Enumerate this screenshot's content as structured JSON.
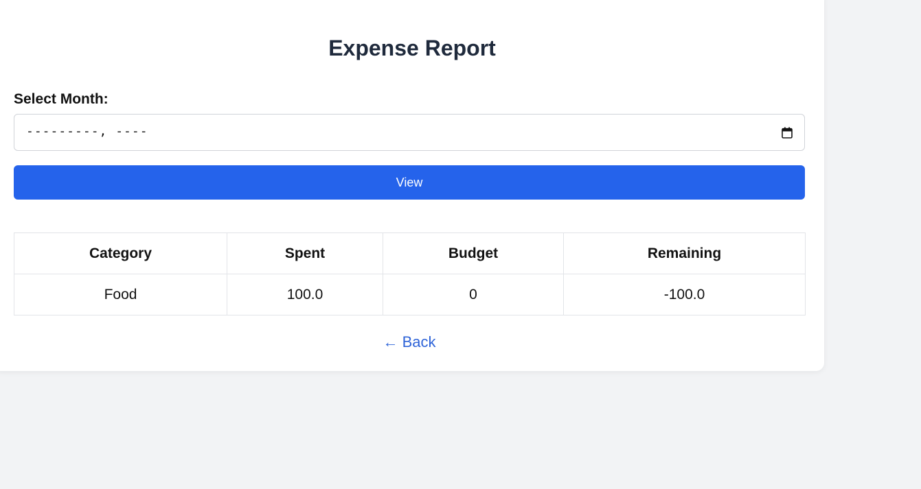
{
  "page": {
    "title": "Expense Report"
  },
  "form": {
    "month_label": "Select Month:",
    "month_placeholder": "---------, ----",
    "calendar_icon": "calendar-icon",
    "view_label": "View"
  },
  "table": {
    "headers": [
      "Category",
      "Spent",
      "Budget",
      "Remaining"
    ],
    "rows": [
      [
        "Food",
        "100.0",
        "0",
        "-100.0"
      ]
    ]
  },
  "nav": {
    "back_label": "← Back"
  },
  "colors": {
    "accent": "#2563eb",
    "link": "#2f64d8",
    "title": "#1f2a3c",
    "background": "#f2f3f5"
  }
}
